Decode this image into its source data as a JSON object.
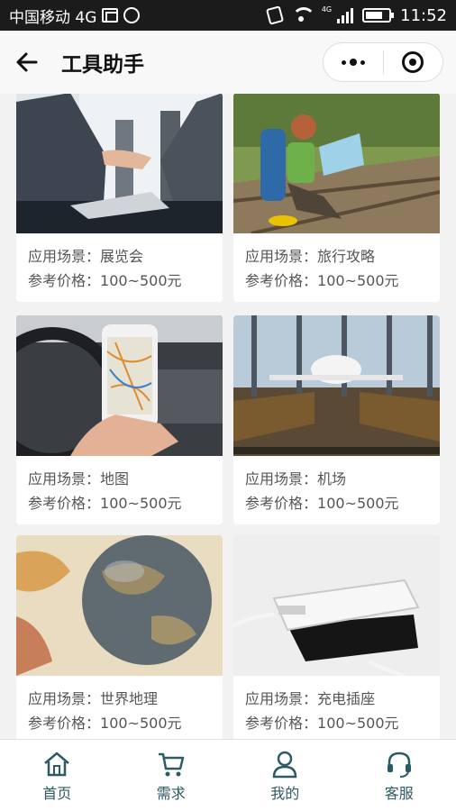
{
  "status_bar": {
    "carrier": "中国移动 4G",
    "network_small": "4G",
    "time": "11:52"
  },
  "nav": {
    "title": "工具助手"
  },
  "cards": [
    {
      "label_scene": "应用场景：",
      "scene": "展览会",
      "label_price": "参考价格：",
      "price": "100~500元",
      "image": "handshake-photo"
    },
    {
      "label_scene": "应用场景：",
      "scene": "旅行攻略",
      "label_price": "参考价格：",
      "price": "100~500元",
      "image": "traveler-photo"
    },
    {
      "label_scene": "应用场景：",
      "scene": "地图",
      "label_price": "参考价格：",
      "price": "100~500元",
      "image": "car-phone-map-photo"
    },
    {
      "label_scene": "应用场景：",
      "scene": "机场",
      "label_price": "参考价格：",
      "price": "100~500元",
      "image": "airport-photo"
    },
    {
      "label_scene": "应用场景：",
      "scene": "世界地理",
      "label_price": "参考价格：",
      "price": "100~500元",
      "image": "globe-photo"
    },
    {
      "label_scene": "应用场景：",
      "scene": "充电插座",
      "label_price": "参考价格：",
      "price": "100~500元",
      "image": "phone-charger-photo"
    }
  ],
  "tabs": [
    {
      "label": "首页",
      "icon": "home-icon"
    },
    {
      "label": "需求",
      "icon": "cart-icon"
    },
    {
      "label": "我的",
      "icon": "user-icon"
    },
    {
      "label": "客服",
      "icon": "headset-icon"
    }
  ],
  "colors": {
    "tab_accent": "#2e5a63",
    "status_bar_bg": "#1b1b1b"
  }
}
